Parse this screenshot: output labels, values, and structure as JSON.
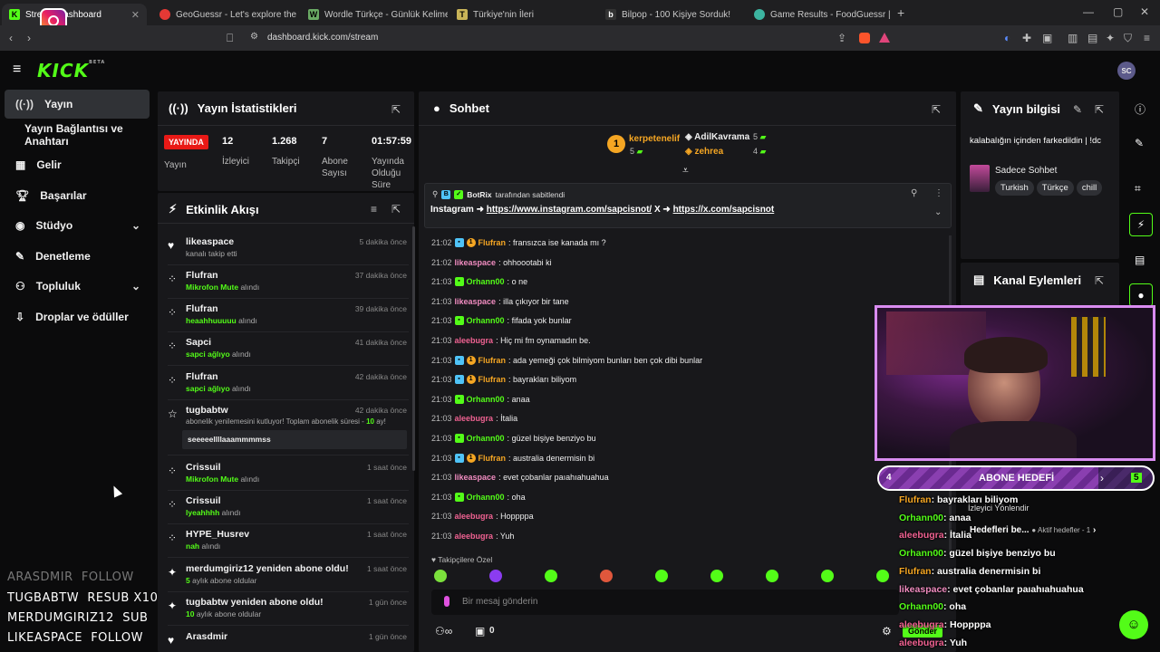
{
  "browser": {
    "tabs": [
      {
        "label": "Stream Dashboard",
        "color": "#53fc18",
        "letter": "K"
      },
      {
        "label": "GeoGuessr - Let's explore the world!",
        "color": "#e53935",
        "letter": "●"
      },
      {
        "label": "Wordle Türkçe - Günlük Kelime Oyunu",
        "color": "#6aaa64",
        "letter": "W"
      },
      {
        "label": "Türkiye'nin İleri",
        "color": "#c9b458",
        "letter": "T"
      },
      {
        "label": "Bilpop - 100 Kişiye Sorduk!",
        "color": "#222222",
        "letter": "b"
      },
      {
        "label": "Game Results - FoodGuessr | FoodG",
        "color": "#3cb4a0",
        "letter": "F"
      }
    ],
    "url": "dashboard.kick.com/stream"
  },
  "header": {
    "logo": "KICK",
    "logo_sup": "BETA"
  },
  "sidebar": {
    "items": [
      {
        "label": "Yayın",
        "icon": "broadcast-icon"
      },
      {
        "label": "Yayın Bağlantısı ve Anahtarı",
        "icon": ""
      },
      {
        "label": "Gelir",
        "icon": "revenue-icon"
      },
      {
        "label": "Başarılar",
        "icon": "trophy-icon"
      },
      {
        "label": "Stüdyo",
        "icon": "studio-icon"
      },
      {
        "label": "Denetleme",
        "icon": "wrench-icon"
      },
      {
        "label": "Topluluk",
        "icon": "community-icon"
      },
      {
        "label": "Droplar ve ödüller",
        "icon": "drops-icon"
      }
    ]
  },
  "stats": {
    "title": "Yayın İstatistikleri",
    "live_label": "YAYINDA",
    "live_sub": "Yayın",
    "viewers": {
      "value": "12",
      "label": "İzleyici"
    },
    "followers": {
      "value": "1.268",
      "label": "Takipçi"
    },
    "subs": {
      "value": "7",
      "label": "Abone Sayısı"
    },
    "uptime": {
      "value": "01:57:59",
      "label": "Yayında Olduğu Süre"
    }
  },
  "activity": {
    "title": "Etkinlik Akışı",
    "items": [
      {
        "name": "likeaspace",
        "sub": "kanalı takip etti",
        "reward": "",
        "time": "5 dakika önce",
        "icon": "♥"
      },
      {
        "name": "Flufran",
        "sub": " alındı",
        "reward": "Mikrofon Mute",
        "time": "37 dakika önce",
        "icon": "●"
      },
      {
        "name": "Flufran",
        "sub": " alındı",
        "reward": "heaahhuuuuu",
        "time": "39 dakika önce",
        "icon": "●"
      },
      {
        "name": "Sapci",
        "sub": " alındı",
        "reward": "sapci ağlıyo",
        "time": "41 dakika önce",
        "icon": "●"
      },
      {
        "name": "Flufran",
        "sub": " alındı",
        "reward": "sapci ağlıyo",
        "time": "42 dakika önce",
        "icon": "●"
      },
      {
        "name": "tugbabtw",
        "sub": "abonelik yenilemesini kutluyor! Toplam abonelik süresi - ",
        "reward": "10",
        "sub2": " ay!",
        "msg": "seeeeellllaaammmmss",
        "time": "42 dakika önce",
        "icon": "★"
      },
      {
        "name": "Crissuil",
        "sub": " alındı",
        "reward": "Mikrofon Mute",
        "time": "1 saat önce",
        "icon": "●"
      },
      {
        "name": "Crissuil",
        "sub": " alındı",
        "reward": "lyeahhhh",
        "time": "1 saat önce",
        "icon": "●"
      },
      {
        "name": "HYPE_Husrev",
        "sub": " alındı",
        "reward": "nah",
        "time": "1 saat önce",
        "icon": "●"
      },
      {
        "name": "merdumgiriz12 yeniden abone oldu!",
        "sub": " aylık abone oldular",
        "reward": "5",
        "time": "1 saat önce",
        "icon": "✦"
      },
      {
        "name": "tugbabtw yeniden abone oldu!",
        "sub": " aylık abone oldular",
        "reward": "10",
        "time": "1 gün önce",
        "icon": "✦"
      },
      {
        "name": "Arasdmir",
        "sub": "",
        "reward": "",
        "time": "1 gün önce",
        "icon": "♥"
      }
    ]
  },
  "chat": {
    "title": "Sohbet",
    "leaderboard": [
      {
        "rank": "1",
        "name": "kerpetenelif",
        "count": "5"
      },
      {
        "rank": "",
        "name": "AdilKavrama",
        "count": "5"
      },
      {
        "rank": "",
        "name": "zehrea",
        "count": "4"
      }
    ],
    "pinned": {
      "author": "BotRix",
      "by": "tarafından sabitlendi",
      "text_pre": "Instagram ➜ ",
      "link1": "https://www.instagram.com/sapcisnot/",
      "text_mid": " X ➜ ",
      "link2": "https://x.com/sapcisnot"
    },
    "messages": [
      {
        "time": "21:02",
        "user": "Flufran",
        "color": "#f5a623",
        "badges": [
          "sub",
          "gift"
        ],
        "text": "fransızca ise kanada mı ?"
      },
      {
        "time": "21:02",
        "user": "likeaspace",
        "color": "#f08cc0",
        "badges": [],
        "text": "ohhoootabi ki"
      },
      {
        "time": "21:03",
        "user": "Orhann00",
        "color": "#53fc18",
        "badges": [
          "sub"
        ],
        "text": "o ne"
      },
      {
        "time": "21:03",
        "user": "likeaspace",
        "color": "#f08cc0",
        "badges": [],
        "text": "illa çıkıyor bir tane"
      },
      {
        "time": "21:03",
        "user": "Orhann00",
        "color": "#53fc18",
        "badges": [
          "sub"
        ],
        "text": "fifada yok bunlar"
      },
      {
        "time": "21:03",
        "user": "aleebugra",
        "color": "#f06292",
        "badges": [],
        "text": "Hiç mi fm oynamadın be."
      },
      {
        "time": "21:03",
        "user": "Flufran",
        "color": "#f5a623",
        "badges": [
          "sub",
          "gift"
        ],
        "text": "ada yemeği çok bilmiyom bunları ben çok dibi bunlar"
      },
      {
        "time": "21:03",
        "user": "Flufran",
        "color": "#f5a623",
        "badges": [
          "sub",
          "gift"
        ],
        "text": "bayrakları biliyom"
      },
      {
        "time": "21:03",
        "user": "Orhann00",
        "color": "#53fc18",
        "badges": [
          "sub"
        ],
        "text": "anaa"
      },
      {
        "time": "21:03",
        "user": "aleebugra",
        "color": "#f06292",
        "badges": [],
        "text": "İtalia"
      },
      {
        "time": "21:03",
        "user": "Orhann00",
        "color": "#53fc18",
        "badges": [
          "sub"
        ],
        "text": "güzel bişiye benziyo bu"
      },
      {
        "time": "21:03",
        "user": "Flufran",
        "color": "#f5a623",
        "badges": [
          "sub",
          "gift"
        ],
        "text": "australia denermisin bi"
      },
      {
        "time": "21:03",
        "user": "likeaspace",
        "color": "#f08cc0",
        "badges": [],
        "text": "evet çobanlar paıahıahuahua"
      },
      {
        "time": "21:03",
        "user": "Orhann00",
        "color": "#53fc18",
        "badges": [
          "sub"
        ],
        "text": "oha"
      },
      {
        "time": "21:03",
        "user": "aleebugra",
        "color": "#f06292",
        "badges": [],
        "text": "Hoppppa"
      },
      {
        "time": "21:03",
        "user": "aleebugra",
        "color": "#f06292",
        "badges": [],
        "text": "Yuh"
      }
    ],
    "followers_only": "Takipçilere Özel",
    "input_placeholder": "Bir mesaj gönderin",
    "send_label": "Gönder",
    "points": "0"
  },
  "stream_info": {
    "title": "Yayın bilgisi",
    "stream_title": "kalabalığın içinden farkedildin | !dc",
    "category": "Sadece Sohbet",
    "tags": [
      "Turkish",
      "Türkçe",
      "chill"
    ]
  },
  "channel_actions": {
    "title": "Kanal Eylemleri"
  },
  "overlay": {
    "goal_label": "ABONE HEDEFİ",
    "goal_current": "4",
    "goal_target": "5",
    "viewer_mode": "İzleyici Yönlendir",
    "goals_row": "Hedefleri be...",
    "active_goals": "Aktif hedefler - 1",
    "chat": [
      {
        "user": "Flufran",
        "color": "#f5a623",
        "text": ": bayrakları biliyom"
      },
      {
        "user": "Orhann00",
        "color": "#53fc18",
        "text": ": anaa"
      },
      {
        "user": "aleebugra",
        "color": "#f06292",
        "text": ": İtalia"
      },
      {
        "user": "Orhann00",
        "color": "#53fc18",
        "text": ": güzel bişiye benziyo bu"
      },
      {
        "user": "Flufran",
        "color": "#f5a623",
        "text": ": australia denermisin bi"
      },
      {
        "user": "likeaspace",
        "color": "#f08cc0",
        "text": ": evet çobanlar paıahıahuahua"
      },
      {
        "user": "Orhann00",
        "color": "#53fc18",
        "text": ": oha"
      },
      {
        "user": "aleebugra",
        "color": "#f06292",
        "text": ": Hoppppa"
      },
      {
        "user": "aleebugra",
        "color": "#f06292",
        "text": ": Yuh"
      }
    ],
    "recent_events": [
      {
        "name": "ARASDMIR",
        "type": "FOLLOW",
        "dim": true
      },
      {
        "name": "TUGBABTW",
        "type": "RESUB X10",
        "dim": false
      },
      {
        "name": "MERDUMGIRIZ12",
        "type": "SUB",
        "dim": false
      },
      {
        "name": "LIKEASPACE",
        "type": "FOLLOW",
        "dim": false
      }
    ]
  },
  "colors": {
    "accent": "#53fc18",
    "live": "#e91916",
    "panel": "#18181b",
    "bg": "#0b0b0c"
  }
}
